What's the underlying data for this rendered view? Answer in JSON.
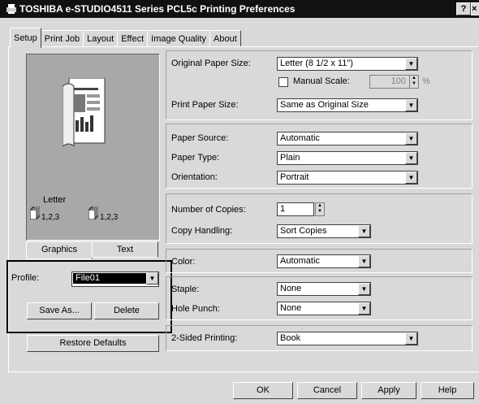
{
  "window": {
    "title": "TOSHIBA e-STUDIO4511 Series PCL5c Printing Preferences",
    "help": "?",
    "close": "×"
  },
  "tabs": [
    "Setup",
    "Print Job",
    "Layout",
    "Effect",
    "Image Quality",
    "About"
  ],
  "preview": {
    "paper_label": "Letter",
    "left_pages_label": "1,2,3",
    "right_pages_label": "1,2,3"
  },
  "graphics_tabs": [
    "Graphics",
    "Text"
  ],
  "profile": {
    "label": "Profile:",
    "value": "File01",
    "save_label": "Save As...",
    "delete_label": "Delete"
  },
  "restore_label": "Restore Defaults",
  "fields": {
    "original_paper_size": {
      "label": "Original Paper Size:",
      "value": "Letter (8 1/2 x 11\")"
    },
    "manual_scale": {
      "label": "Manual Scale:",
      "value": "100",
      "unit": "%"
    },
    "print_paper_size": {
      "label": "Print Paper Size:",
      "value": "Same as Original Size"
    },
    "paper_source": {
      "label": "Paper Source:",
      "value": "Automatic"
    },
    "paper_type": {
      "label": "Paper Type:",
      "value": "Plain"
    },
    "orientation": {
      "label": "Orientation:",
      "value": "Portrait"
    },
    "copies": {
      "label": "Number of Copies:",
      "value": "1"
    },
    "copy_handling": {
      "label": "Copy Handling:",
      "value": "Sort Copies"
    },
    "color": {
      "label": "Color:",
      "value": "Automatic"
    },
    "staple": {
      "label": "Staple:",
      "value": "None"
    },
    "hole_punch": {
      "label": "Hole Punch:",
      "value": "None"
    },
    "two_sided": {
      "label": "2-Sided Printing:",
      "value": "Book"
    }
  },
  "footer": {
    "ok": "OK",
    "cancel": "Cancel",
    "apply": "Apply",
    "help": "Help"
  }
}
